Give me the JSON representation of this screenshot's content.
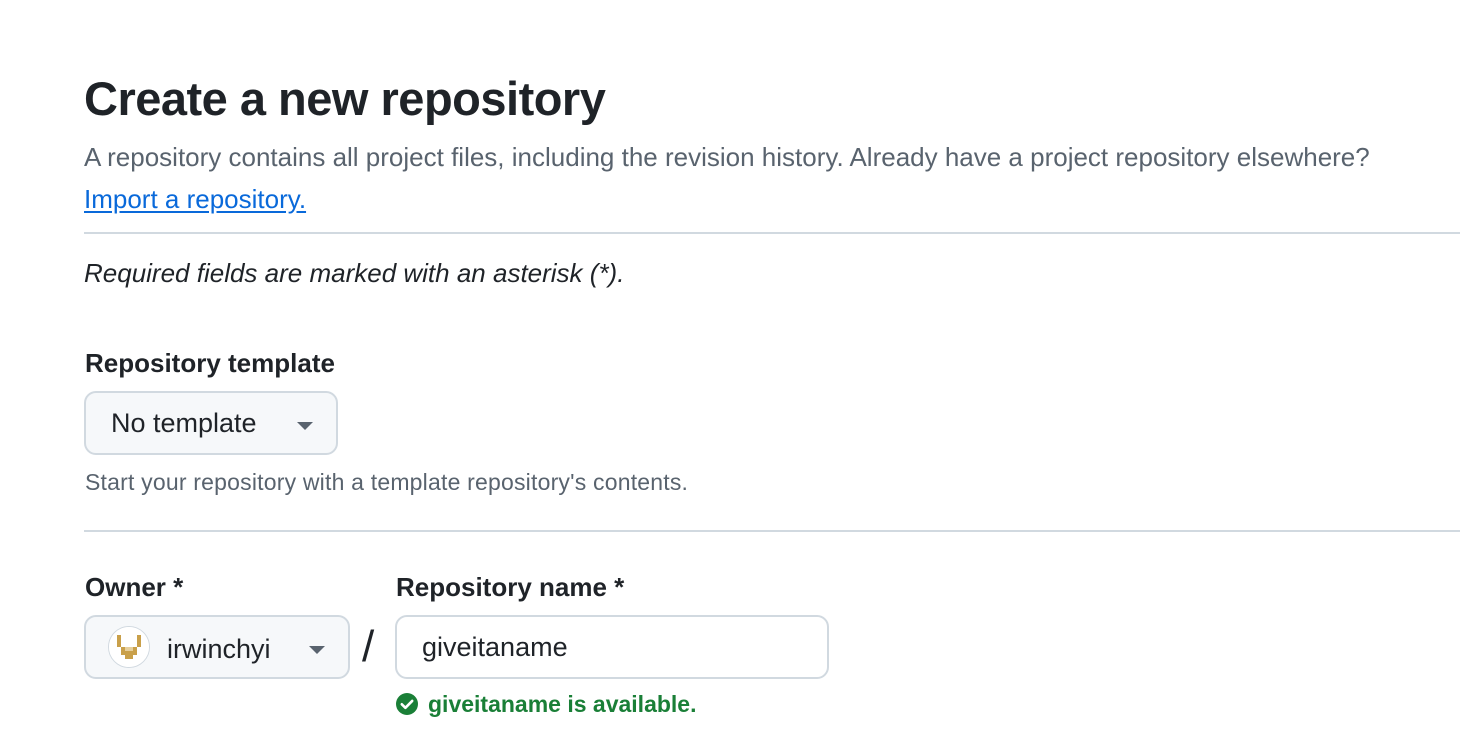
{
  "header": {
    "title": "Create a new repository",
    "description": "A repository contains all project files, including the revision history. Already have a project repository elsewhere?",
    "import_link": "Import a repository."
  },
  "form": {
    "required_note": "Required fields are marked with an asterisk (*).",
    "template": {
      "label": "Repository template",
      "selected": "No template",
      "hint": "Start your repository with a template repository's contents."
    },
    "owner": {
      "label": "Owner *",
      "selected": "irwinchyi"
    },
    "separator": "/",
    "repository_name": {
      "label": "Repository name *",
      "value": "giveitaname",
      "availability": "giveitaname is available."
    }
  },
  "colors": {
    "link": "#0969da",
    "success": "#1a7f37",
    "muted_text": "#59636e",
    "border": "#d1d9e0",
    "avatar_accent": "#c9a04a"
  },
  "icons": {
    "dropdown": "triangle-down-icon",
    "availability": "check-circle-fill-icon",
    "avatar": "identicon-avatar"
  }
}
